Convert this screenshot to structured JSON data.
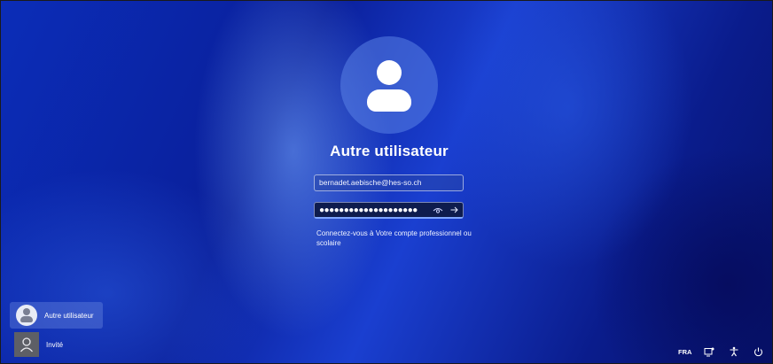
{
  "login": {
    "username": "Autre utilisateur",
    "email_value": "bernadet.aebische@hes-so.ch",
    "password_masked": "●●●●●●●●●●●●●●●●●●●●",
    "hint": "Connectez-vous à Votre compte professionnel ou scolaire"
  },
  "user_switcher": {
    "items": [
      {
        "label": "Autre utilisateur",
        "selected": true
      },
      {
        "label": "Invité",
        "selected": false
      }
    ]
  },
  "tray": {
    "language": "FRA",
    "icons": [
      "network-icon",
      "accessibility-icon",
      "power-icon"
    ]
  },
  "colors": {
    "background": "#0a1f9a",
    "accent": "#7fa6ff"
  }
}
